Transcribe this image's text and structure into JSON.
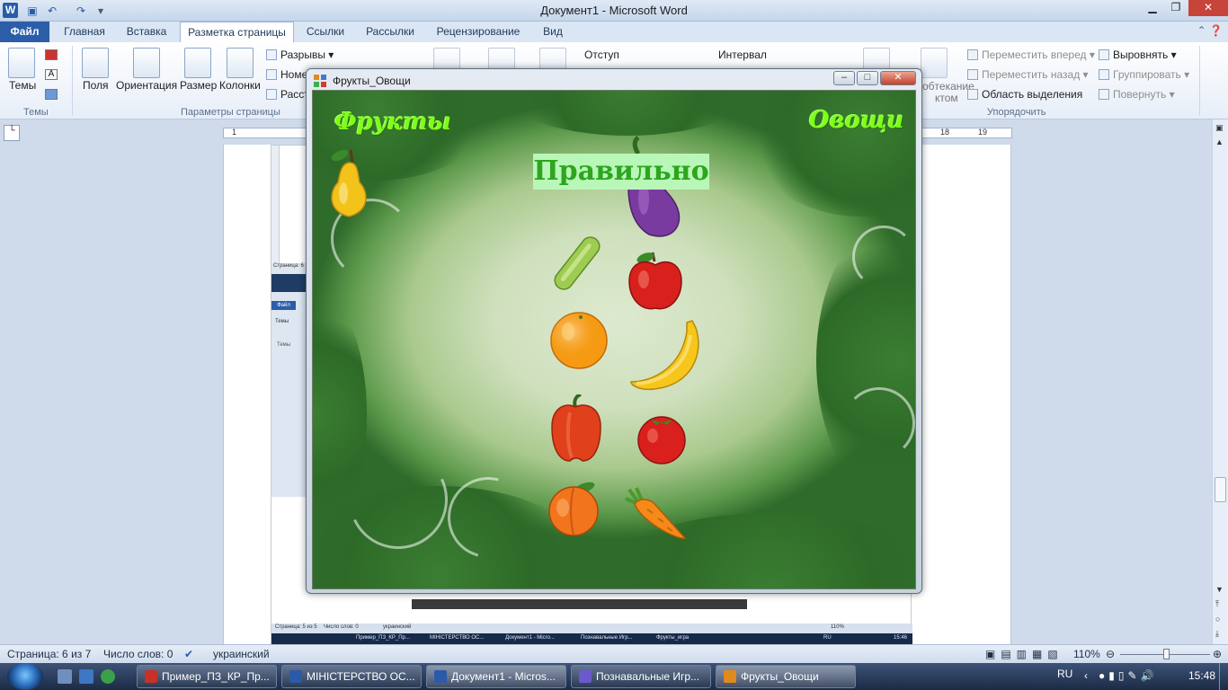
{
  "word": {
    "title": "Документ1  -  Microsoft Word",
    "logo": "W",
    "window_controls": {
      "minimize": "▁",
      "maximize": "❐",
      "close": "✕"
    },
    "qat_icons": [
      "save-icon",
      "undo-icon",
      "redo-icon",
      "customize-icon"
    ],
    "tabs": [
      "Файл",
      "Главная",
      "Вставка",
      "Разметка страницы",
      "Ссылки",
      "Рассылки",
      "Рецензирование",
      "Вид"
    ],
    "active_tab": "Разметка страницы",
    "ribbon": {
      "themes": {
        "label": "Темы",
        "group": "Темы"
      },
      "page_setup": {
        "fields": "Поля",
        "orientation": "Ориентация",
        "size": "Размер",
        "columns": "Колонки",
        "breaks": "Разрывы",
        "line_numbers": "Номе",
        "hyphenation": "Расст",
        "group": "Параметры страницы"
      },
      "indent": "Отступ",
      "spacing": "Интервал",
      "wrap_text": "обтекание",
      "wrap_text2": "ктом",
      "arrange": {
        "bring_forward": "Переместить вперед",
        "send_backward": "Переместить назад",
        "selection_pane": "Область выделения",
        "align": "Выровнять",
        "group_btn": "Группировать",
        "rotate": "Повернуть",
        "group": "Упорядочить"
      }
    },
    "ruler_numbers": [
      "1",
      "18",
      "19"
    ],
    "status": {
      "page": "Страница: 6 из 7",
      "words": "Число слов: 0",
      "language": "украинский",
      "zoom": "110%"
    }
  },
  "embedded": {
    "title": "Страница: 6",
    "file_tab": "Файл",
    "themes": "Темы",
    "themes2": "Темы",
    "status": [
      "Страница: 5 из 5",
      "Число слов: 0",
      "украинский",
      "110%"
    ],
    "taskbar": [
      "Пример_ПЗ_КР_Пр...",
      "МІНІСТЕРСТВО ОС...",
      "Документ1 - Micro...",
      "Познавальные Игр...",
      "Фрукты_игра"
    ],
    "tray": [
      "RU",
      "15:46"
    ]
  },
  "taskbar": {
    "items": [
      {
        "label": "Пример_ПЗ_КР_Пр...",
        "icon": "pdf-icon",
        "color": "#c8302a"
      },
      {
        "label": "МІНІСТЕРСТВО ОС...",
        "icon": "word-icon",
        "color": "#2a5ba8"
      },
      {
        "label": "Документ1 - Micros...",
        "icon": "word-icon",
        "color": "#2a5ba8"
      },
      {
        "label": "Познавальные Игр...",
        "icon": "app-icon",
        "color": "#6a5acd"
      },
      {
        "label": "Фрукты_Овощи",
        "icon": "form-icon",
        "color": "#e08a1e"
      }
    ],
    "lang": "RU",
    "clock": "15:48"
  },
  "game": {
    "title": "Фрукты_Овощи",
    "controls": {
      "minimize": "‒",
      "maximize": "□",
      "close": "✕"
    },
    "label_left": "Фрукты",
    "label_right": "Овощи",
    "verdict": "Правильно",
    "items": [
      "pear-icon",
      "eggplant-icon",
      "cucumber-icon",
      "apple-icon",
      "orange-icon",
      "banana-icon",
      "bell-pepper-icon",
      "tomato-icon",
      "peach-icon",
      "carrot-icon"
    ]
  }
}
